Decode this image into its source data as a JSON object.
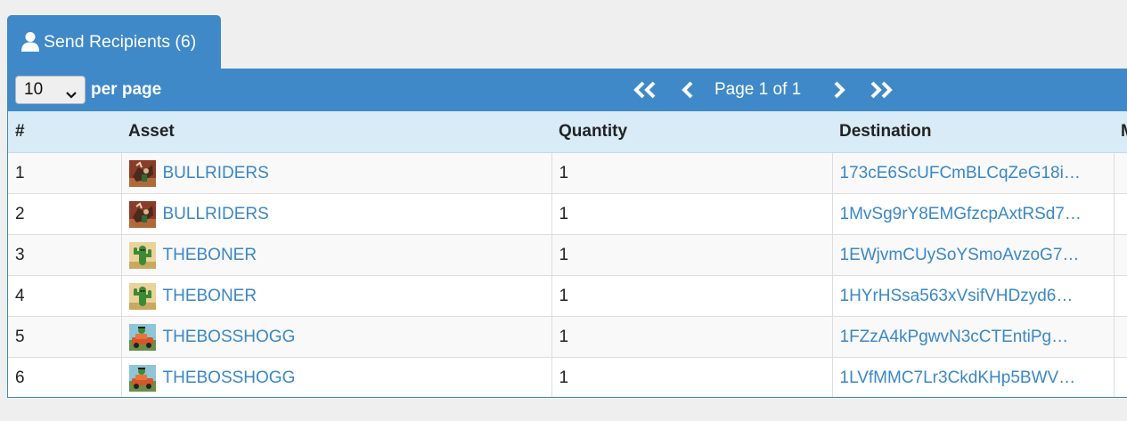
{
  "tab": {
    "label": "Send Recipients (6)",
    "icon": "user-icon"
  },
  "toolbar": {
    "per_page_value": "10",
    "per_page_options": [
      "10"
    ],
    "per_page_label": "per page",
    "page_text": "Page 1 of 1",
    "icons": [
      "double-chevron-left-icon",
      "chevron-left-icon",
      "chevron-right-icon",
      "double-chevron-right-icon"
    ]
  },
  "table": {
    "columns": [
      "#",
      "Asset",
      "Quantity",
      "Destination",
      "M"
    ],
    "rows": [
      {
        "num": "1",
        "asset": "BULLRIDERS",
        "thumb": "bull",
        "quantity": "1",
        "destination": "173cE6ScUFCmBLCqZeG18i…"
      },
      {
        "num": "2",
        "asset": "BULLRIDERS",
        "thumb": "bull",
        "quantity": "1",
        "destination": "1MvSg9rY8EMGfzcpAxtRSd7…"
      },
      {
        "num": "3",
        "asset": "THEBONER",
        "thumb": "boner",
        "quantity": "1",
        "destination": "1EWjvmCUySoYSmoAvzoG7…"
      },
      {
        "num": "4",
        "asset": "THEBONER",
        "thumb": "boner",
        "quantity": "1",
        "destination": "1HYrHSsa563xVsifVHDzyd6…"
      },
      {
        "num": "5",
        "asset": "THEBOSSHOGG",
        "thumb": "hogg",
        "quantity": "1",
        "destination": "1FZzA4kPgwvN3cCTEntiPg…"
      },
      {
        "num": "6",
        "asset": "THEBOSSHOGG",
        "thumb": "hogg",
        "quantity": "1",
        "destination": "1LVfMMC7Lr3CkdKHp5BWV…"
      }
    ]
  },
  "colors": {
    "accent": "#3f89c9",
    "header_bg": "#d8ebf6",
    "link": "#3a87c6"
  }
}
